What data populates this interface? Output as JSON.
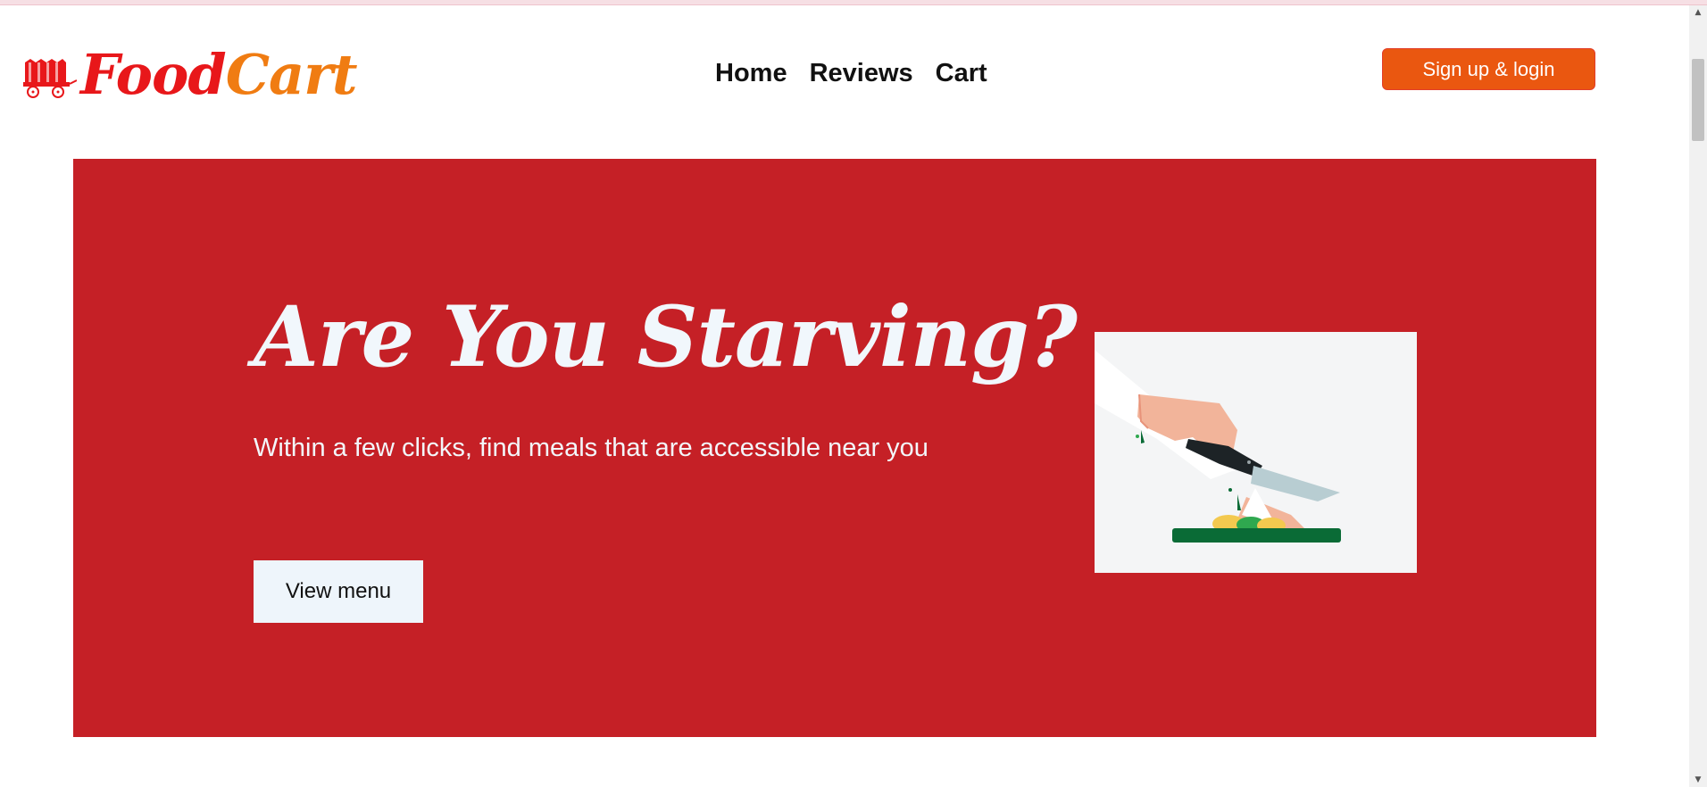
{
  "brand": {
    "name_part1": "Food",
    "name_part2": "Cart",
    "logo_icon": "wagon-icon",
    "colors": {
      "part1": "#e8171a",
      "part2": "#f07c12"
    }
  },
  "nav": {
    "links": [
      {
        "label": "Home"
      },
      {
        "label": "Reviews"
      },
      {
        "label": "Cart"
      }
    ],
    "signup_label": "Sign up & login"
  },
  "hero": {
    "title": "Are You Starving?",
    "subtitle": "Within a few clicks, find meals that are accessible near you",
    "cta_label": "View menu",
    "background_color": "#c52026",
    "illustration": "hands-chopping-vegetables-illustration"
  },
  "colors": {
    "accent": "#ea5710",
    "hero_bg": "#c52026"
  }
}
